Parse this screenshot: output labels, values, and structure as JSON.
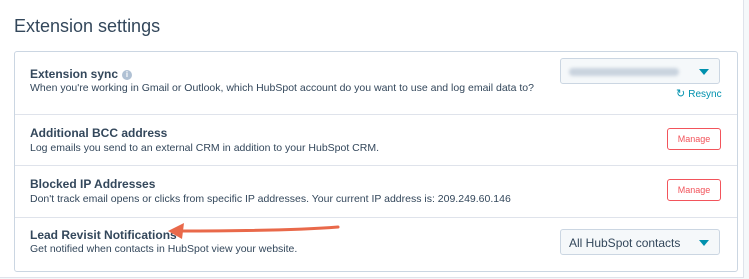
{
  "title": "Extension settings",
  "rows": [
    {
      "title": "Extension sync",
      "desc": "When you're working in Gmail or Outlook, which HubSpot account do you want to use and log email data to?",
      "resync": "Resync",
      "dropdown_value": ""
    },
    {
      "title": "Additional BCC address",
      "desc": "Log emails you send to an external CRM in addition to your HubSpot CRM.",
      "button": "Manage"
    },
    {
      "title": "Blocked IP Addresses",
      "desc": "Don't track email opens or clicks from specific IP addresses. Your current IP address is: 209.249.60.146",
      "button": "Manage"
    },
    {
      "title": "Lead Revisit Notifications",
      "desc": "Get notified when contacts in HubSpot view your website.",
      "dropdown_value": "All HubSpot contacts"
    }
  ],
  "icons": {
    "info": "info-icon",
    "resync": "refresh-icon",
    "annotation": "red-arrow-annotation"
  },
  "colors": {
    "link": "#0091ae",
    "button": "#f2545b",
    "arrow": "#e9694a"
  }
}
